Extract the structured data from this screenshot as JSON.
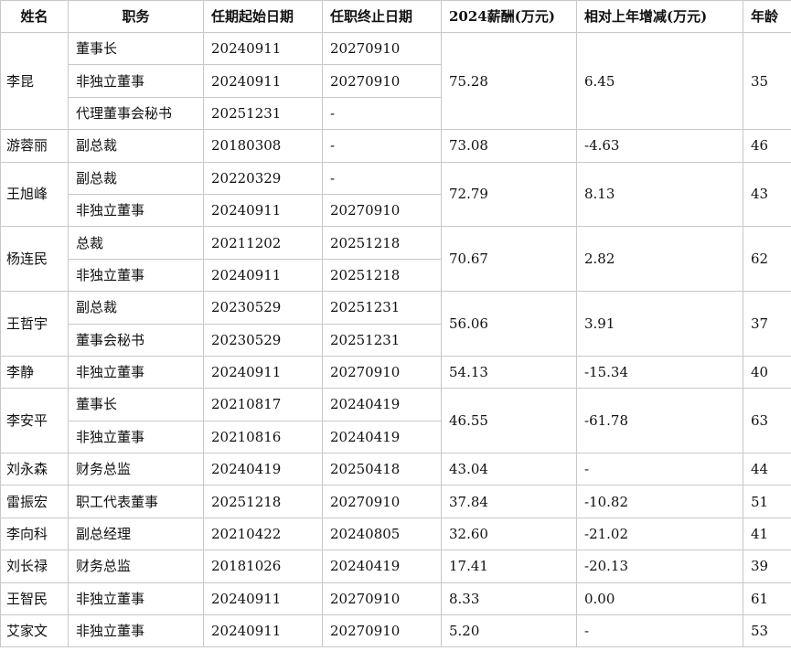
{
  "headers": [
    "姓名",
    "职务",
    "任期起始日期",
    "任职终止日期",
    "2024薪酬(万元)",
    "相对上年增减(万元)",
    "年龄"
  ],
  "people": [
    {
      "name": "李昆",
      "salary": "75.28",
      "change": "6.45",
      "age": "35",
      "roles": [
        {
          "title": "董事长",
          "start": "20240911",
          "end": "20270910"
        },
        {
          "title": "非独立董事",
          "start": "20240911",
          "end": "20270910"
        },
        {
          "title": "代理董事会秘书",
          "start": "20251231",
          "end": "-"
        }
      ]
    },
    {
      "name": "游蓉丽",
      "salary": "73.08",
      "change": "-4.63",
      "age": "46",
      "roles": [
        {
          "title": "副总裁",
          "start": "20180308",
          "end": "-"
        }
      ]
    },
    {
      "name": "王旭峰",
      "salary": "72.79",
      "change": "8.13",
      "age": "43",
      "roles": [
        {
          "title": "副总裁",
          "start": "20220329",
          "end": "-"
        },
        {
          "title": "非独立董事",
          "start": "20240911",
          "end": "20270910"
        }
      ]
    },
    {
      "name": "杨连民",
      "salary": "70.67",
      "change": "2.82",
      "age": "62",
      "roles": [
        {
          "title": "总裁",
          "start": "20211202",
          "end": "20251218"
        },
        {
          "title": "非独立董事",
          "start": "20240911",
          "end": "20251218"
        }
      ]
    },
    {
      "name": "王哲宇",
      "salary": "56.06",
      "change": "3.91",
      "age": "37",
      "roles": [
        {
          "title": "副总裁",
          "start": "20230529",
          "end": "20251231"
        },
        {
          "title": "董事会秘书",
          "start": "20230529",
          "end": "20251231"
        }
      ]
    },
    {
      "name": "李静",
      "salary": "54.13",
      "change": "-15.34",
      "age": "40",
      "roles": [
        {
          "title": "非独立董事",
          "start": "20240911",
          "end": "20270910"
        }
      ]
    },
    {
      "name": "李安平",
      "salary": "46.55",
      "change": "-61.78",
      "age": "63",
      "roles": [
        {
          "title": "董事长",
          "start": "20210817",
          "end": "20240419"
        },
        {
          "title": "非独立董事",
          "start": "20210816",
          "end": "20240419"
        }
      ]
    },
    {
      "name": "刘永森",
      "salary": "43.04",
      "change": "-",
      "age": "44",
      "roles": [
        {
          "title": "财务总监",
          "start": "20240419",
          "end": "20250418"
        }
      ]
    },
    {
      "name": "雷振宏",
      "salary": "37.84",
      "change": "-10.82",
      "age": "51",
      "roles": [
        {
          "title": "职工代表董事",
          "start": "20251218",
          "end": "20270910"
        }
      ]
    },
    {
      "name": "李向科",
      "salary": "32.60",
      "change": "-21.02",
      "age": "41",
      "roles": [
        {
          "title": "副总经理",
          "start": "20210422",
          "end": "20240805"
        }
      ]
    },
    {
      "name": "刘长禄",
      "salary": "17.41",
      "change": "-20.13",
      "age": "39",
      "roles": [
        {
          "title": "财务总监",
          "start": "20181026",
          "end": "20240419"
        }
      ]
    },
    {
      "name": "王智民",
      "salary": "8.33",
      "change": "0.00",
      "age": "61",
      "roles": [
        {
          "title": "非独立董事",
          "start": "20240911",
          "end": "20270910"
        }
      ]
    },
    {
      "name": "艾家文",
      "salary": "5.20",
      "change": "-",
      "age": "53",
      "roles": [
        {
          "title": "非独立董事",
          "start": "20240911",
          "end": "20270910"
        }
      ]
    }
  ]
}
